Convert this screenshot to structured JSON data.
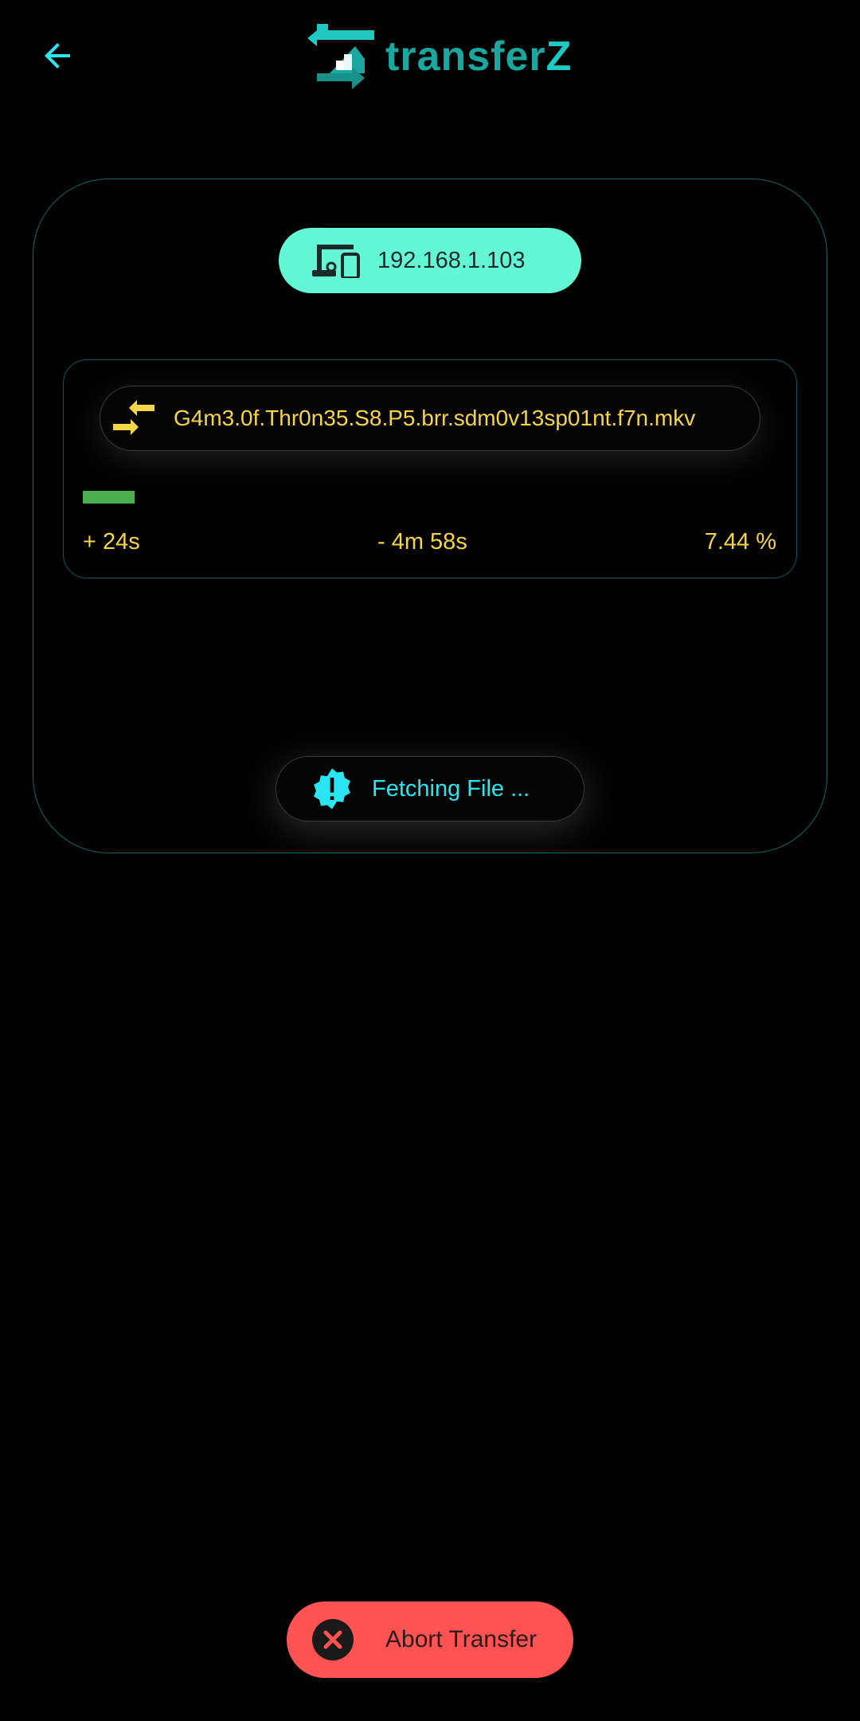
{
  "app": {
    "logo_text_main": "transfer",
    "logo_text_accent": "Z"
  },
  "device": {
    "ip": "192.168.1.103",
    "icon": "devices-icon"
  },
  "transfer": {
    "file_name": "G4m3.0f.Thr0n35.S8.P5.brr.sdm0v13sp01nt.f7n.mkv",
    "elapsed": "+ 24s",
    "remaining": "- 4m 58s",
    "percent_text": "7.44 %",
    "progress_fraction": 0.0744,
    "progress_color": "#4caf50"
  },
  "status": {
    "label": "Fetching File ...",
    "icon": "alert-badge-icon"
  },
  "actions": {
    "abort_label": "Abort Transfer",
    "abort_icon": "close-circle-icon"
  },
  "colors": {
    "accent_cyan": "#29e6f2",
    "device_pill": "#64f7d5",
    "file_text": "#f6d54b",
    "abort": "#ff5252",
    "card_border": "#14686a"
  }
}
